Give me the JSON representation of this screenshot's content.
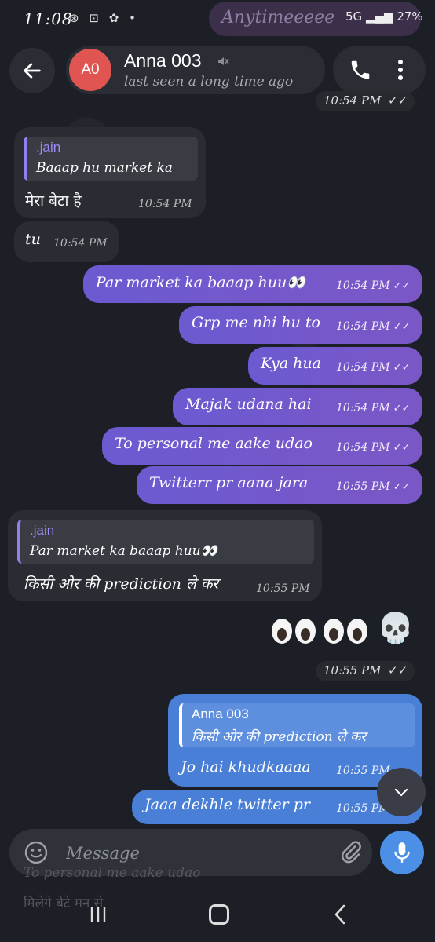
{
  "status": {
    "time": "11:08",
    "pill_text": "Anytimeeeee",
    "battery": "27%",
    "network": "5G"
  },
  "header": {
    "avatar_initials": "A0",
    "contact_name": "Anna 003",
    "last_seen": "last seen a long time ago",
    "top_time": "10:54 PM"
  },
  "messages": [
    {
      "dir": "in",
      "quote_name": ".jain",
      "quote_text": "Baaap hu market ka",
      "text": "मेरा बेटा है",
      "time": "10:54 PM"
    },
    {
      "dir": "in",
      "text": "tu",
      "time": "10:54 PM"
    },
    {
      "dir": "out",
      "text": "Par market ka baaap huu👀",
      "time": "10:54 PM"
    },
    {
      "dir": "out",
      "text": "Grp me nhi hu to",
      "time": "10:54 PM"
    },
    {
      "dir": "out",
      "text": "Kya hua",
      "time": "10:54 PM"
    },
    {
      "dir": "out",
      "text": "Majak udana hai",
      "time": "10:54 PM"
    },
    {
      "dir": "out",
      "text": "To personal me aake udao",
      "time": "10:54 PM"
    },
    {
      "dir": "out",
      "text": "Twitterr pr aana jara",
      "time": "10:55 PM"
    },
    {
      "dir": "in",
      "quote_name": ".jain",
      "quote_text": "Par market ka baaap huu👀",
      "text": "किसी ओर की prediction ले कर",
      "time": "10:55 PM"
    },
    {
      "dir": "out",
      "emoji": "👀👀👀💀",
      "time": "10:55 PM"
    },
    {
      "dir": "out",
      "quote_name": "Anna 003",
      "quote_text": "किसी ओर की prediction ले कर",
      "text": "Jo hai khudkaaaa",
      "time": "10:55 PM"
    },
    {
      "dir": "out",
      "text": "Jaaa dekhle twitter pr",
      "time": "10:55 PM"
    }
  ],
  "input": {
    "placeholder": "Message"
  },
  "ghost_lines": [
    "To personal me aake udao",
    "मिलेगे बेटे मन से"
  ],
  "colors": {
    "accent_out": "#6c5ad1",
    "accent_blue": "#4a7fd8",
    "bubble_in": "#2a2c33",
    "avatar": "#e05551"
  }
}
